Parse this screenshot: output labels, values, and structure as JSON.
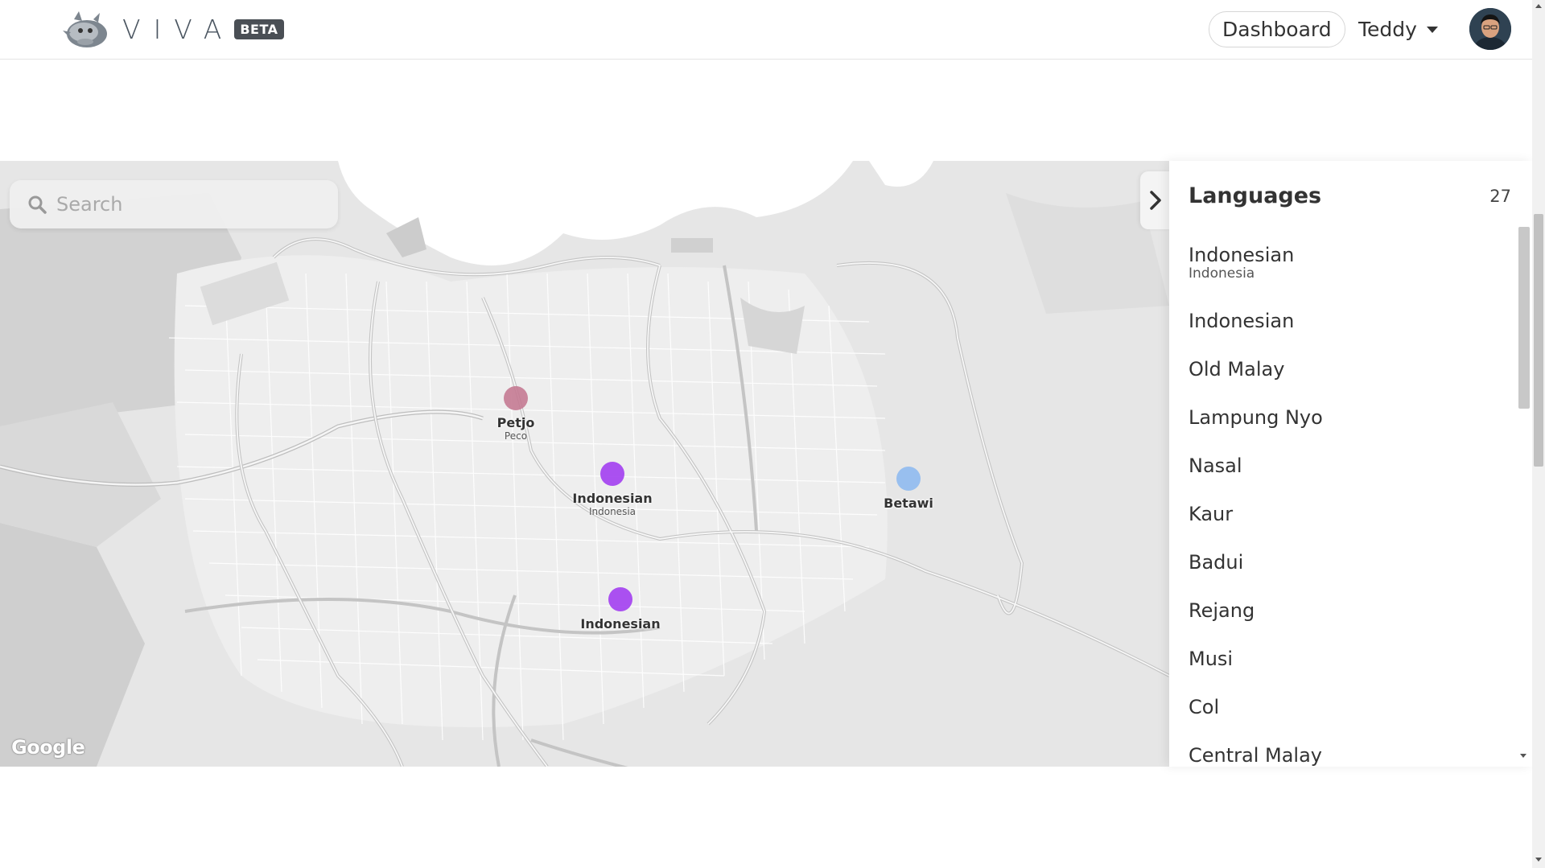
{
  "header": {
    "logo_text": "VIVA",
    "beta_badge": "BETA",
    "dashboard_label": "Dashboard",
    "user_name": "Teddy"
  },
  "search": {
    "placeholder": "Search"
  },
  "map": {
    "attribution": "Google",
    "markers": [
      {
        "name": "Petjo",
        "sub": "Peco",
        "color": "#c47a92"
      },
      {
        "name": "Indonesian",
        "sub": "Indonesia",
        "color": "#a23ef0"
      },
      {
        "name": "Betawi",
        "sub": "",
        "color": "#8fbaf0"
      },
      {
        "name": "Indonesian",
        "sub": "",
        "color": "#a23ef0"
      }
    ]
  },
  "panel": {
    "title": "Languages",
    "count": "27",
    "items": [
      {
        "name": "Indonesian",
        "sub": "Indonesia"
      },
      {
        "name": "Indonesian"
      },
      {
        "name": "Old Malay"
      },
      {
        "name": "Lampung Nyo"
      },
      {
        "name": "Nasal"
      },
      {
        "name": "Kaur"
      },
      {
        "name": "Badui"
      },
      {
        "name": "Rejang"
      },
      {
        "name": "Musi"
      },
      {
        "name": "Col"
      },
      {
        "name": "Central Malay"
      }
    ]
  }
}
